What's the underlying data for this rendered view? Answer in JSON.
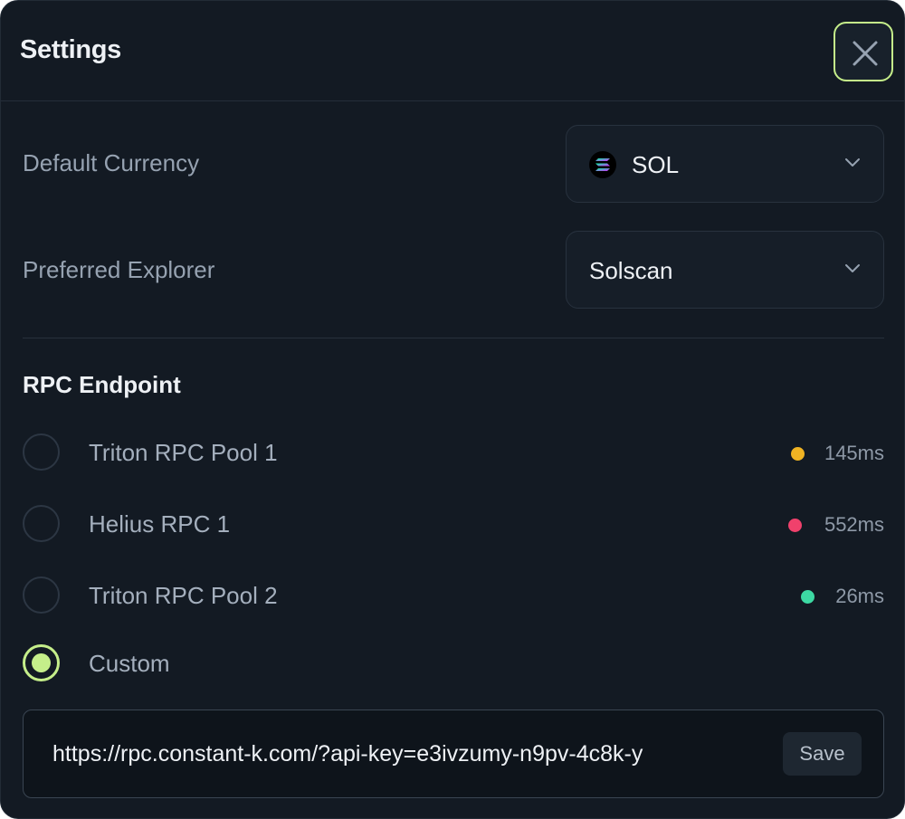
{
  "header": {
    "title": "Settings",
    "close_icon": "close-icon"
  },
  "settings": {
    "currency": {
      "label": "Default Currency",
      "value": "SOL",
      "icon": "solana-logo-icon"
    },
    "explorer": {
      "label": "Preferred Explorer",
      "value": "Solscan"
    }
  },
  "rpc": {
    "title": "RPC Endpoint",
    "options": [
      {
        "name": "Triton RPC Pool 1",
        "latency": "145ms",
        "status_color": "#f0b323",
        "selected": false
      },
      {
        "name": "Helius RPC 1",
        "latency": "552ms",
        "status_color": "#f0416c",
        "selected": false
      },
      {
        "name": "Triton RPC Pool 2",
        "latency": "26ms",
        "status_color": "#3dd9a3",
        "selected": false
      },
      {
        "name": "Custom",
        "latency": "",
        "status_color": "",
        "selected": true
      }
    ],
    "custom": {
      "value": "https://rpc.constant-k.com/?api-key=e3ivzumy-n9pv-4c8k-y",
      "save_label": "Save"
    }
  },
  "colors": {
    "accent": "#c5ee8a",
    "background": "#131a23"
  }
}
